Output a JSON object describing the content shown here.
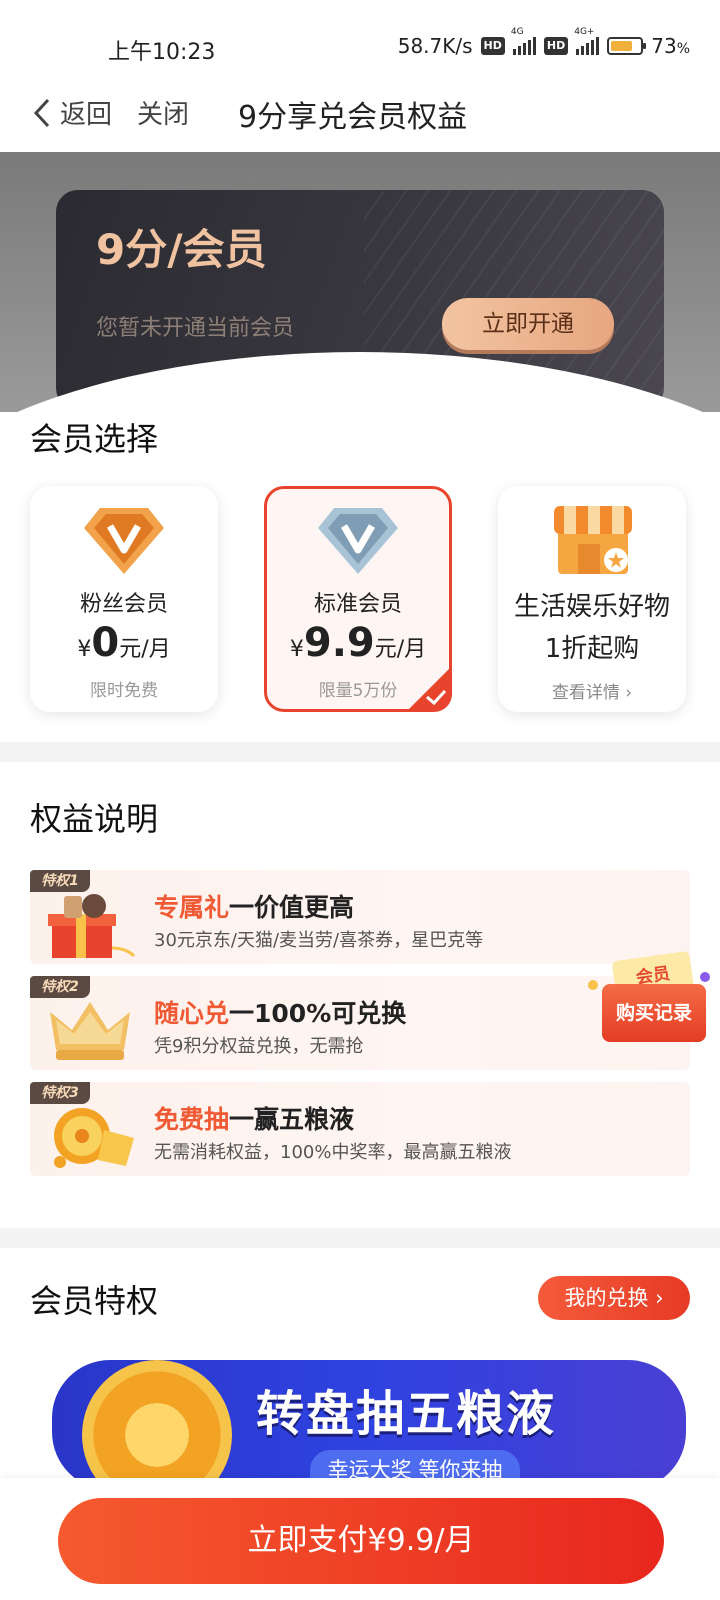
{
  "status": {
    "time": "上午10:23",
    "speed": "58.7K/s",
    "hd1": "HD",
    "net1": "4G",
    "hd2": "HD",
    "net2": "4G+",
    "battery": "73",
    "battery_unit": "%",
    "battery_level": 0.73
  },
  "nav": {
    "back": "返回",
    "close": "关闭",
    "title": "9分享兑会员权益"
  },
  "hero": {
    "title": "9分/会员",
    "subtitle": "您暂未开通当前会员",
    "button": "立即开通"
  },
  "plans_section": {
    "title": "会员选择"
  },
  "plans": [
    {
      "name": "粉丝会员",
      "currency": "¥",
      "price": "0",
      "unit": "元/月",
      "note": "限时免费",
      "selected": false
    },
    {
      "name": "标准会员",
      "currency": "¥",
      "price": "9.9",
      "unit": "元/月",
      "note": "限量5万份",
      "selected": true
    },
    {
      "name": "生活娱乐好物",
      "line2": "1折起购",
      "note": "查看详情",
      "selected": false
    }
  ],
  "benefits_section": {
    "title": "权益说明"
  },
  "benefits": [
    {
      "tag": "特权1",
      "highlight": "专属礼",
      "rest": "一价值更高",
      "desc": "30元京东/天猫/麦当劳/喜茶券，星巴克等"
    },
    {
      "tag": "特权2",
      "highlight": "随心兑",
      "rest": "一100%可兑换",
      "desc": "凭9积分权益兑换，无需抢"
    },
    {
      "tag": "特权3",
      "highlight": "免费抽",
      "rest": "一赢五粮液",
      "desc": "无需消耗权益，100%中奖率，最高赢五粮液"
    }
  ],
  "float_badge": {
    "top": "会员",
    "label": "购买记录"
  },
  "privileges_section": {
    "title": "会员特权",
    "button": "我的兑换"
  },
  "banner": {
    "title": "转盘抽五粮液",
    "subtitle": "幸运大奖 等你来抽"
  },
  "pay": {
    "label": "立即支付¥9.9/月"
  },
  "colors": {
    "accent": "#e8432c",
    "gold": "#f0c2a0"
  }
}
